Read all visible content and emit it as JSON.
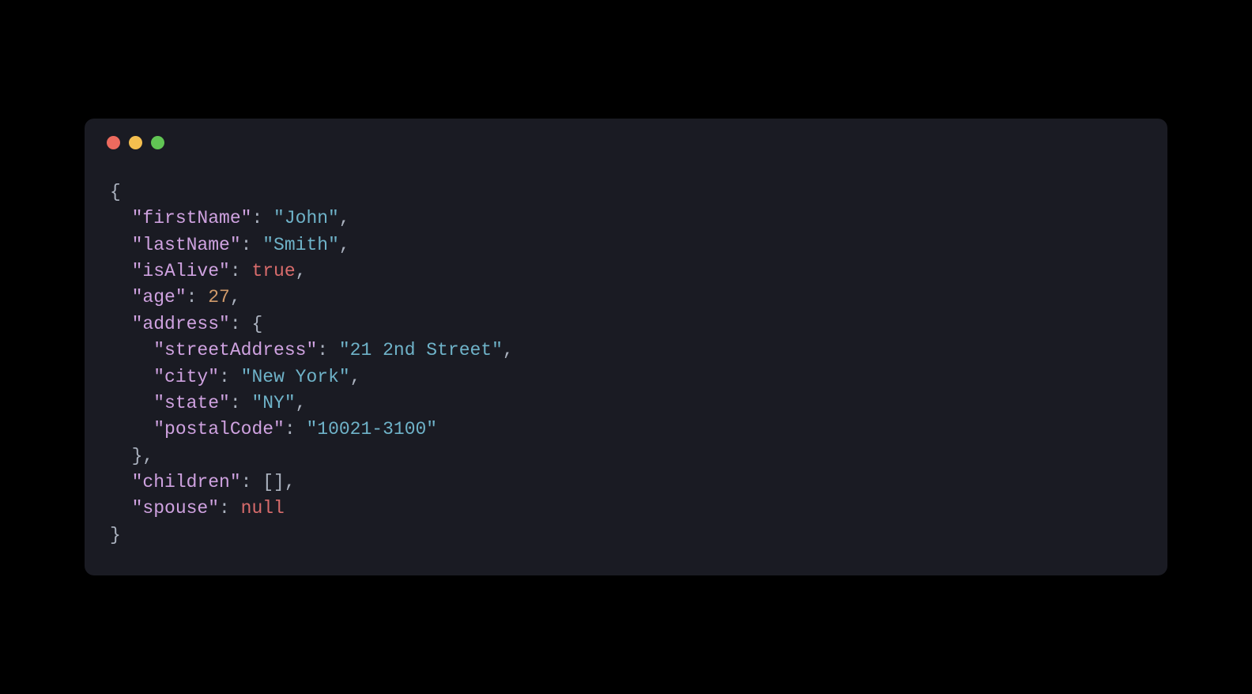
{
  "window": {
    "traffic_lights": [
      "close",
      "minimize",
      "zoom"
    ]
  },
  "code_tokens": [
    [
      {
        "t": "brace",
        "v": "{"
      }
    ],
    [
      {
        "t": "indent",
        "v": "  "
      },
      {
        "t": "key",
        "v": "\"firstName\""
      },
      {
        "t": "colon",
        "v": ": "
      },
      {
        "t": "string",
        "v": "\"John\""
      },
      {
        "t": "comma",
        "v": ","
      }
    ],
    [
      {
        "t": "indent",
        "v": "  "
      },
      {
        "t": "key",
        "v": "\"lastName\""
      },
      {
        "t": "colon",
        "v": ": "
      },
      {
        "t": "string",
        "v": "\"Smith\""
      },
      {
        "t": "comma",
        "v": ","
      }
    ],
    [
      {
        "t": "indent",
        "v": "  "
      },
      {
        "t": "key",
        "v": "\"isAlive\""
      },
      {
        "t": "colon",
        "v": ": "
      },
      {
        "t": "bool",
        "v": "true"
      },
      {
        "t": "comma",
        "v": ","
      }
    ],
    [
      {
        "t": "indent",
        "v": "  "
      },
      {
        "t": "key",
        "v": "\"age\""
      },
      {
        "t": "colon",
        "v": ": "
      },
      {
        "t": "number",
        "v": "27"
      },
      {
        "t": "comma",
        "v": ","
      }
    ],
    [
      {
        "t": "indent",
        "v": "  "
      },
      {
        "t": "key",
        "v": "\"address\""
      },
      {
        "t": "colon",
        "v": ": "
      },
      {
        "t": "brace",
        "v": "{"
      }
    ],
    [
      {
        "t": "indent",
        "v": "    "
      },
      {
        "t": "key",
        "v": "\"streetAddress\""
      },
      {
        "t": "colon",
        "v": ": "
      },
      {
        "t": "string",
        "v": "\"21 2nd Street\""
      },
      {
        "t": "comma",
        "v": ","
      }
    ],
    [
      {
        "t": "indent",
        "v": "    "
      },
      {
        "t": "key",
        "v": "\"city\""
      },
      {
        "t": "colon",
        "v": ": "
      },
      {
        "t": "string",
        "v": "\"New York\""
      },
      {
        "t": "comma",
        "v": ","
      }
    ],
    [
      {
        "t": "indent",
        "v": "    "
      },
      {
        "t": "key",
        "v": "\"state\""
      },
      {
        "t": "colon",
        "v": ": "
      },
      {
        "t": "string",
        "v": "\"NY\""
      },
      {
        "t": "comma",
        "v": ","
      }
    ],
    [
      {
        "t": "indent",
        "v": "    "
      },
      {
        "t": "key",
        "v": "\"postalCode\""
      },
      {
        "t": "colon",
        "v": ": "
      },
      {
        "t": "string",
        "v": "\"10021-3100\""
      }
    ],
    [
      {
        "t": "indent",
        "v": "  "
      },
      {
        "t": "brace",
        "v": "}"
      },
      {
        "t": "comma",
        "v": ","
      }
    ],
    [
      {
        "t": "indent",
        "v": "  "
      },
      {
        "t": "key",
        "v": "\"children\""
      },
      {
        "t": "colon",
        "v": ": "
      },
      {
        "t": "bracket",
        "v": "[]"
      },
      {
        "t": "comma",
        "v": ","
      }
    ],
    [
      {
        "t": "indent",
        "v": "  "
      },
      {
        "t": "key",
        "v": "\"spouse\""
      },
      {
        "t": "colon",
        "v": ": "
      },
      {
        "t": "null",
        "v": "null"
      }
    ],
    [
      {
        "t": "brace",
        "v": "}"
      }
    ]
  ],
  "json_value": {
    "firstName": "John",
    "lastName": "Smith",
    "isAlive": true,
    "age": 27,
    "address": {
      "streetAddress": "21 2nd Street",
      "city": "New York",
      "state": "NY",
      "postalCode": "10021-3100"
    },
    "children": [],
    "spouse": null
  }
}
